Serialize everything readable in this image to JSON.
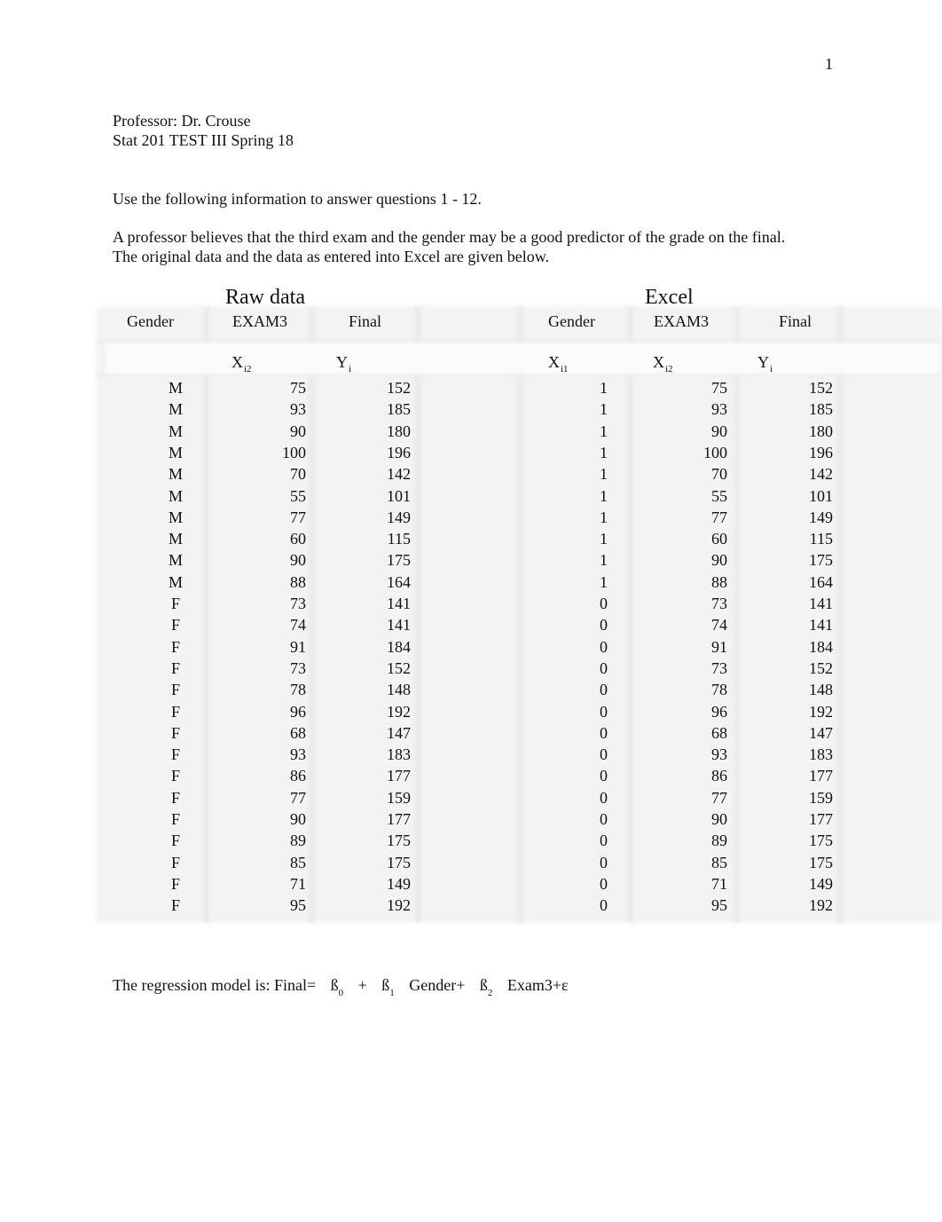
{
  "page_number": "1",
  "header": {
    "professor": "Professor: Dr. Crouse",
    "course": "Stat 201 TEST III Spring 18"
  },
  "instructions": "Use the following information to answer questions 1 - 12.",
  "description": {
    "line1": "A professor believes that the third exam and the gender may be a good predictor of the grade on the final.",
    "line2": "The original data and the data as entered into Excel are given below."
  },
  "raw_table": {
    "title": "Raw data",
    "headers": [
      "Gender",
      "EXAM3",
      "Final"
    ],
    "symbols": [
      {
        "base": "",
        "sub": ""
      },
      {
        "base": "X",
        "sub": "i2"
      },
      {
        "base": "Y",
        "sub": "i"
      }
    ],
    "rows": [
      [
        "M",
        "75",
        "152"
      ],
      [
        "M",
        "93",
        "185"
      ],
      [
        "M",
        "90",
        "180"
      ],
      [
        "M",
        "100",
        "196"
      ],
      [
        "M",
        "70",
        "142"
      ],
      [
        "M",
        "55",
        "101"
      ],
      [
        "M",
        "77",
        "149"
      ],
      [
        "M",
        "60",
        "115"
      ],
      [
        "M",
        "90",
        "175"
      ],
      [
        "M",
        "88",
        "164"
      ],
      [
        "F",
        "73",
        "141"
      ],
      [
        "F",
        "74",
        "141"
      ],
      [
        "F",
        "91",
        "184"
      ],
      [
        "F",
        "73",
        "152"
      ],
      [
        "F",
        "78",
        "148"
      ],
      [
        "F",
        "96",
        "192"
      ],
      [
        "F",
        "68",
        "147"
      ],
      [
        "F",
        "93",
        "183"
      ],
      [
        "F",
        "86",
        "177"
      ],
      [
        "F",
        "77",
        "159"
      ],
      [
        "F",
        "90",
        "177"
      ],
      [
        "F",
        "89",
        "175"
      ],
      [
        "F",
        "85",
        "175"
      ],
      [
        "F",
        "71",
        "149"
      ],
      [
        "F",
        "95",
        "192"
      ]
    ]
  },
  "excel_table": {
    "title": "Excel",
    "headers": [
      "Gender",
      "EXAM3",
      "Final"
    ],
    "symbols": [
      {
        "base": "X",
        "sub": "i1"
      },
      {
        "base": "X",
        "sub": "i2"
      },
      {
        "base": "Y",
        "sub": "i"
      }
    ],
    "rows": [
      [
        "1",
        "75",
        "152"
      ],
      [
        "1",
        "93",
        "185"
      ],
      [
        "1",
        "90",
        "180"
      ],
      [
        "1",
        "100",
        "196"
      ],
      [
        "1",
        "70",
        "142"
      ],
      [
        "1",
        "55",
        "101"
      ],
      [
        "1",
        "77",
        "149"
      ],
      [
        "1",
        "60",
        "115"
      ],
      [
        "1",
        "90",
        "175"
      ],
      [
        "1",
        "88",
        "164"
      ],
      [
        "0",
        "73",
        "141"
      ],
      [
        "0",
        "74",
        "141"
      ],
      [
        "0",
        "91",
        "184"
      ],
      [
        "0",
        "73",
        "152"
      ],
      [
        "0",
        "78",
        "148"
      ],
      [
        "0",
        "96",
        "192"
      ],
      [
        "0",
        "68",
        "147"
      ],
      [
        "0",
        "93",
        "183"
      ],
      [
        "0",
        "86",
        "177"
      ],
      [
        "0",
        "77",
        "159"
      ],
      [
        "0",
        "90",
        "177"
      ],
      [
        "0",
        "89",
        "175"
      ],
      [
        "0",
        "85",
        "175"
      ],
      [
        "0",
        "71",
        "149"
      ],
      [
        "0",
        "95",
        "192"
      ]
    ]
  },
  "regression": {
    "prefix": "The regression model is: Final=",
    "beta_symbol": "ß",
    "b0_sub": "0",
    "plus": "+",
    "b1_sub": "1",
    "term1": "Gender+",
    "b2_sub": "2",
    "term2": "Exam3+ε"
  }
}
